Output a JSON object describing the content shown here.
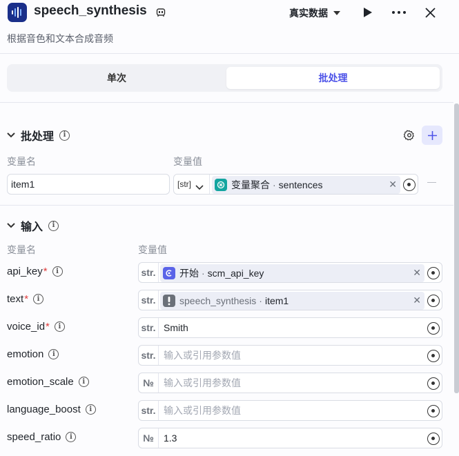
{
  "header": {
    "title": "speech_synthesis",
    "subtitle": "根据音色和文本合成音频",
    "mode": "真实数据"
  },
  "tabs": [
    {
      "label": "单次"
    },
    {
      "label": "批处理"
    }
  ],
  "batch": {
    "title": "批处理",
    "col_name": "变量名",
    "col_value": "变量值",
    "item_name": "item1",
    "type_label": "[str]",
    "ref_source": "变量聚合",
    "ref_sep": "·",
    "ref_var": "sentences",
    "minus": "—"
  },
  "input": {
    "title": "输入",
    "col_name": "变量名",
    "col_value": "变量值",
    "required_mark": "*",
    "placeholder": "输入或引用参数值",
    "rows": [
      {
        "name": "api_key",
        "required": true,
        "type": "str.",
        "ref_source": "开始",
        "ref_var": "scm_api_key"
      },
      {
        "name": "text",
        "required": true,
        "type": "str.",
        "ref_source": "speech_synthesis",
        "ref_var": "item1"
      },
      {
        "name": "voice_id",
        "required": true,
        "type": "str.",
        "value": "Smith"
      },
      {
        "name": "emotion",
        "required": false,
        "type": "str."
      },
      {
        "name": "emotion_scale",
        "required": false,
        "type": "№"
      },
      {
        "name": "language_boost",
        "required": false,
        "type": "str."
      },
      {
        "name": "speed_ratio",
        "required": false,
        "type": "№",
        "value": "1.3"
      }
    ]
  },
  "colors": {
    "accent": "#4d53e8",
    "teal": "#14a5a0",
    "indigo": "#5a63e8",
    "gray_icon": "#6b7079"
  }
}
